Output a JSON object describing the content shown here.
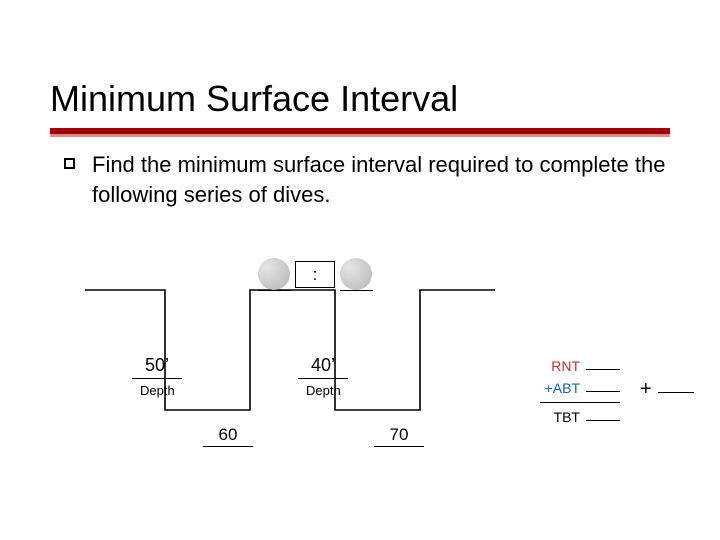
{
  "title": "Minimum Surface Interval",
  "body": "Find the minimum surface interval required to complete the following series of dives.",
  "surface_interval_sep": ":",
  "dive1": {
    "depth": "50’",
    "depth_label": "Depth",
    "bottom_time": "60"
  },
  "dive2": {
    "depth": "40’",
    "depth_label": "Depth",
    "bottom_time": "70"
  },
  "labels": {
    "rnt": "RNT",
    "abt": "+ABT",
    "tbt": "TBT"
  },
  "plus": "+"
}
